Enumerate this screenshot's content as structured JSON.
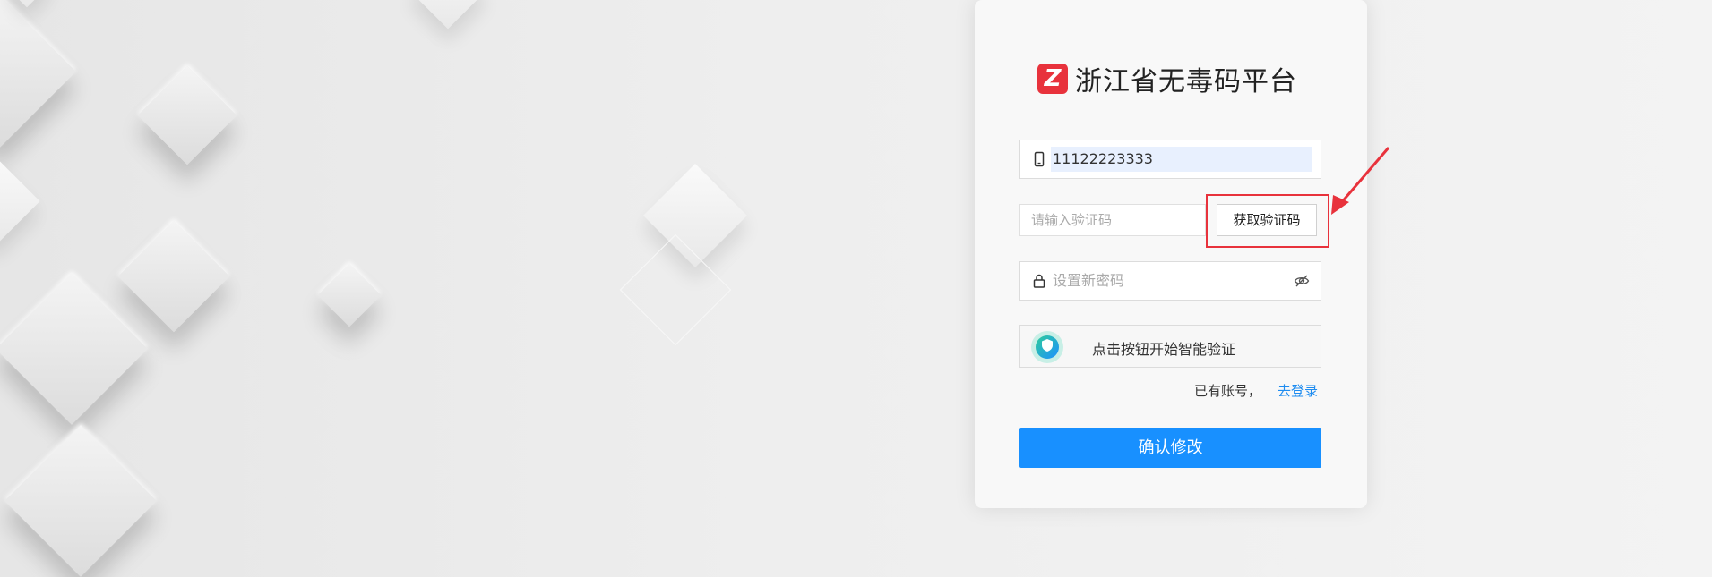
{
  "app": {
    "title": "浙江省无毒码平台",
    "logo_letter": "Z",
    "brand_color": "#e8323c"
  },
  "form": {
    "phone_value": "11122223333",
    "code_placeholder": "请输入验证码",
    "get_code_label": "获取验证码",
    "password_placeholder": "设置新密码",
    "verify_label": "点击按钮开始智能验证",
    "has_account_text": "已有账号，",
    "login_link": "去登录",
    "submit_label": "确认修改",
    "submit_color": "#1890ff"
  },
  "icons": {
    "phone": "phone-icon",
    "lock": "lock-icon",
    "eye_off": "eye-off-icon",
    "shield": "shield-icon"
  },
  "annotation": {
    "highlight_color": "#e8323c"
  }
}
